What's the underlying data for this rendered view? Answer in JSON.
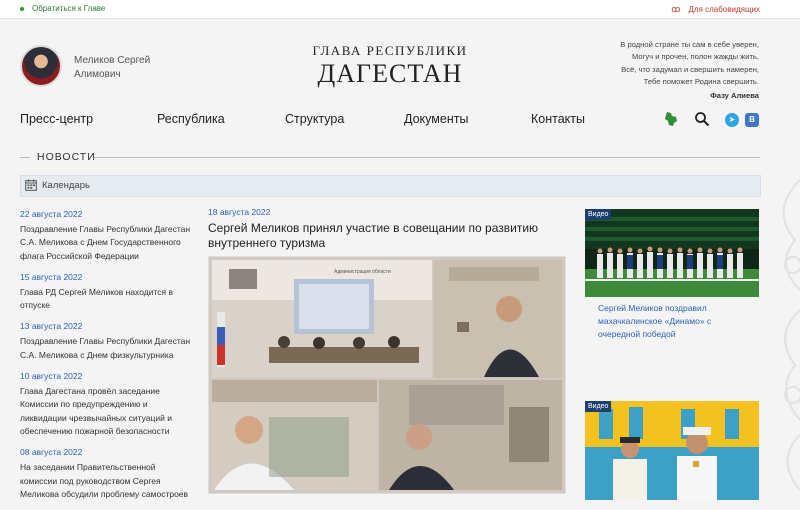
{
  "topbar": {
    "appeal_label": "Обратиться к Главе",
    "impaired_label": "Для слабовидящих"
  },
  "header": {
    "leader_name": "Меликов Сергей Алимович",
    "title_sub": "ГЛАВА РЕСПУБЛИКИ",
    "title_main": "ДАГЕСТАН",
    "poem_lines": [
      "В родной стране ты сам в себе уверен,",
      "Могуч и прочен, полон жажды жить,",
      "Всё, что задумал и свершить намерен,",
      "Тебе поможет Родина свершить."
    ],
    "poem_author": "Фазу Алиева"
  },
  "nav": {
    "items": [
      "Пресс-центр",
      "Республика",
      "Структура",
      "Документы",
      "Контакты"
    ],
    "icons": [
      "dagestan-map-icon",
      "search-icon",
      "telegram-icon",
      "vk-icon"
    ],
    "vk_text": "В"
  },
  "news": {
    "section_title": "НОВОСТИ",
    "calendar_label": "Календарь",
    "items": [
      {
        "date": "22 августа 2022",
        "text": "Поздравление Главы Республики Дагестан С.А. Меликова с Днем Государственного флага Российской Федерации"
      },
      {
        "date": "15 августа 2022",
        "text": "Глава РД Сергей Меликов находится в отпуске"
      },
      {
        "date": "13 августа 2022",
        "text": "Поздравление Главы Республики Дагестан С.А. Меликова с Днем физкультурника"
      },
      {
        "date": "10 августа 2022",
        "text": "Глава Дагестана провёл заседание Комиссии по предупреждению и ликвидации чрезвычайных ситуаций и обеспечению пожарной безопасности"
      },
      {
        "date": "08 августа 2022",
        "text": "На заседании Правительственной комиссии под руководством Сергея Меликова обсудили проблему самостроев"
      }
    ]
  },
  "main_article": {
    "date": "18 августа 2022",
    "title": "Сергей Меликов принял участие в совещании по развитию внутреннего туризма",
    "photo_sign": "Администрация области"
  },
  "side": {
    "cards": [
      {
        "badge": "Видео",
        "caption": "Сергей Меликов поздравил махачкалинское «Динамо» с очередной победой"
      },
      {
        "badge": "Видео",
        "caption": ""
      }
    ]
  },
  "colors": {
    "link_blue": "#2a62b8",
    "impaired_red": "#c0392b",
    "appeal_green": "#2b7a2b",
    "badge_navy": "#1c3f6e"
  }
}
